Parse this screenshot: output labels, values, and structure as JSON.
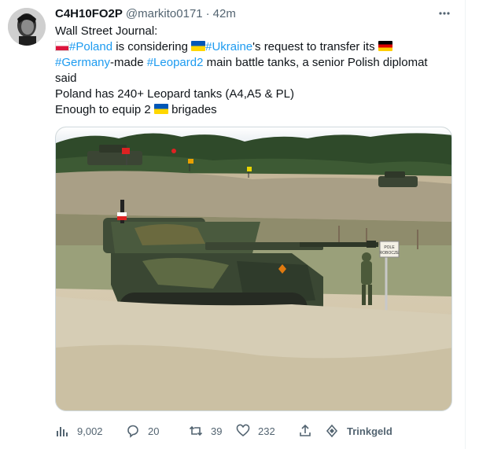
{
  "tweet": {
    "author_name": "C4H10FO2P",
    "handle": "@markito0171",
    "separator": "·",
    "time": "42m",
    "more_icon": "ellipsis-icon",
    "lines": {
      "l1": "Wall Street Journal:",
      "l2_tag1": "#Poland",
      "l2_mid": " is considering ",
      "l2_tag2": "#Ukraine",
      "l2_end": "'s request to transfer its ",
      "l3_tag1": "#Germany",
      "l3_mid": "-made ",
      "l3_tag2": "#Leopard2",
      "l3_end": " main battle tanks, a senior Polish diplomat",
      "l4": "said",
      "l5": "Poland has 240+ Leopard tanks (A4,A5 & PL)",
      "l6_start": "Enough to equip 2 ",
      "l6_end": " brigades"
    },
    "flags": [
      "poland-flag",
      "ukraine-flag",
      "germany-flag",
      "ukraine-flag"
    ],
    "media": {
      "sign_text_1": "POLE",
      "sign_text_2": "ROBOCZE"
    },
    "actions": {
      "views": "9,002",
      "replies": "20",
      "retweets": "39",
      "likes": "232",
      "tip": "Trinkgeld"
    }
  },
  "colors": {
    "link": "#1d9bf0",
    "secondary_text": "#536471",
    "primary_text": "#0f1419"
  }
}
